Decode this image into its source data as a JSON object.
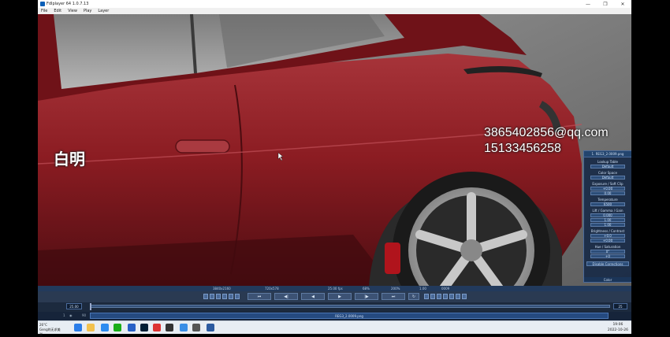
{
  "window": {
    "title": "Fdlplayer 64 1.0.7.13",
    "minimize": "—",
    "maximize": "❐",
    "close": "✕"
  },
  "menu": [
    "File",
    "Edit",
    "View",
    "Play",
    "Layer"
  ],
  "overlay": {
    "left_text": "白明",
    "email": "3865402856@qq.com",
    "phone": "15133456258"
  },
  "panel": {
    "file": "1. REG3_2.0009.png",
    "lookup_table_label": "Lookup Table",
    "lookup_table_value": "Default",
    "color_space_label": "Color Space",
    "color_space_value": "Default",
    "exposure_label": "Exposure / Soft Clip",
    "exposure_value": "+0.00",
    "softclip_value": "0.00",
    "temperature_label": "Temperature",
    "temperature_value": "6500",
    "lgg_label": "Lift / Gamma / Gain",
    "lift_value": "0.000",
    "gamma_value": "1.00",
    "gain_value": "1.00",
    "bc_label": "Brightness / Contrast",
    "brightness_value": "+0.0",
    "contrast_value": "+0.00",
    "hs_label": "Hue / Saturation",
    "hue_value": "0°",
    "saturation_value": "+0",
    "disable_button": "Disable Corrections",
    "color_tab": "Color"
  },
  "status": {
    "resolution": "3840x2160",
    "viewport": "720x578",
    "fps": "25.00 fps",
    "pct": "68%",
    "zoom": "200%",
    "ratio": "1.00",
    "extra": "0009"
  },
  "timeline": {
    "start_frame": "25.00",
    "end_frame": "25",
    "layer_index": "1",
    "layer_name": "REG3_2.0009.png",
    "frame_marker": "90"
  },
  "taskbar": {
    "weather_line1": "26°C",
    "weather_line2": "Geng的无求美滋",
    "time": "19:06",
    "date": "2022-10-26"
  },
  "colors": {
    "car_red": "#8b1c22",
    "panel_bg": "#142846",
    "status_bg": "#223a5c"
  }
}
